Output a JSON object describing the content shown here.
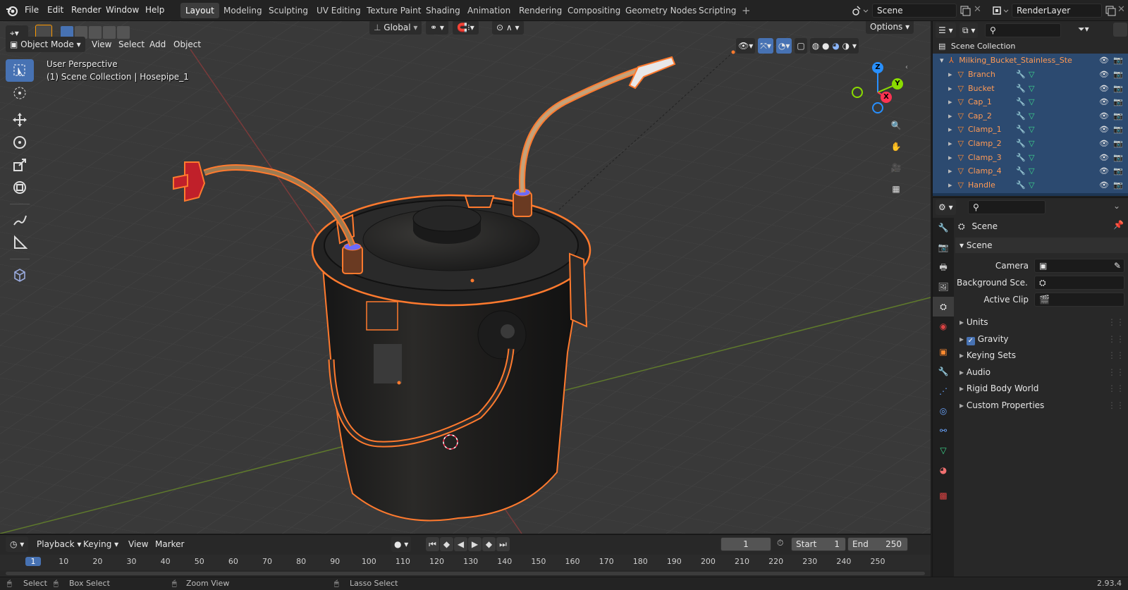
{
  "menu": {
    "items": [
      "File",
      "Edit",
      "Render",
      "Window",
      "Help"
    ]
  },
  "workspaces": [
    "Layout",
    "Modeling",
    "Sculpting",
    "UV Editing",
    "Texture Paint",
    "Shading",
    "Animation",
    "Rendering",
    "Compositing",
    "Geometry Nodes",
    "Scripting"
  ],
  "active_workspace": "Layout",
  "add_workspace": "+",
  "scene_field": "Scene",
  "layer_field": "RenderLayer",
  "viewport_header": {
    "transform_orientation": "Global",
    "options": "Options",
    "mode": "Object Mode",
    "view": "View",
    "select": "Select",
    "add": "Add",
    "object": "Object"
  },
  "viewport_overlay": {
    "perspective": "User Perspective",
    "collection_info": "(1) Scene Collection | Hosepipe_1"
  },
  "gizmo": {
    "z": "Z",
    "y": "Y",
    "x": "X"
  },
  "outliner": {
    "root": "Scene Collection",
    "collection": "Milking_Bucket_Stainless_Ste",
    "objects": [
      "Branch",
      "Bucket",
      "Cap_1",
      "Cap_2",
      "Clamp_1",
      "Clamp_2",
      "Clamp_3",
      "Clamp_4",
      "Handle"
    ]
  },
  "properties": {
    "header": "Scene",
    "panel_scene": "Scene",
    "camera_label": "Camera",
    "background_label": "Background Sce...",
    "active_clip_label": "Active Clip",
    "panels": [
      "Units",
      "Gravity",
      "Keying Sets",
      "Audio",
      "Rigid Body World",
      "Custom Properties"
    ],
    "gravity_checked": true
  },
  "timeline": {
    "playback": "Playback",
    "keying": "Keying",
    "view": "View",
    "marker": "Marker",
    "current_frame": "1",
    "start_label": "Start",
    "start_value": "1",
    "end_label": "End",
    "end_value": "250",
    "ruler": [
      "1",
      "10",
      "20",
      "30",
      "40",
      "50",
      "60",
      "70",
      "80",
      "90",
      "100",
      "110",
      "120",
      "130",
      "140",
      "150",
      "160",
      "170",
      "180",
      "190",
      "200",
      "210",
      "220",
      "230",
      "240",
      "250"
    ]
  },
  "statusbar": {
    "select": "Select",
    "box_select": "Box Select",
    "zoom_view": "Zoom View",
    "lasso_select": "Lasso Select",
    "version": "2.93.4"
  },
  "colors": {
    "selection_orange": "#ff7a2e",
    "active_blue": "#4772b3",
    "outliner_selected": "#2c4a70",
    "x_axis": "#ff3352",
    "y_axis": "#8bdc00",
    "z_axis": "#2890ff"
  }
}
